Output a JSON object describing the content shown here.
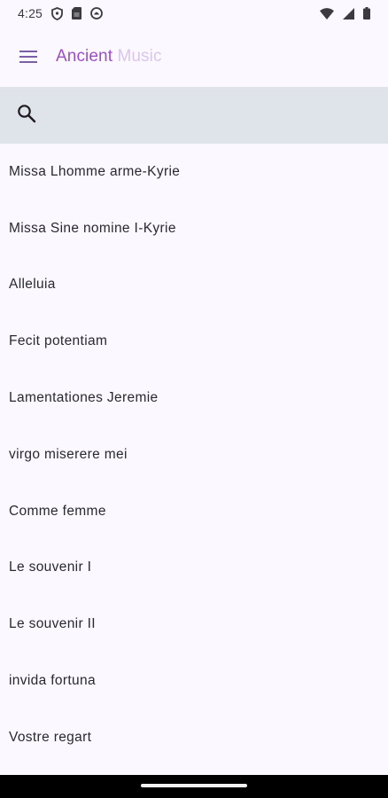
{
  "status_bar": {
    "time": "4:25",
    "left_icons": [
      "shield-icon",
      "sim-card-icon",
      "vpn-badge-icon"
    ],
    "right_icons": [
      "wifi-icon",
      "cell-signal-icon",
      "battery-icon"
    ]
  },
  "app_bar": {
    "title_part1": "Ancient",
    "title_part2": " Music",
    "menu_icon": "hamburger-menu-icon"
  },
  "search": {
    "icon": "search-icon",
    "value": "",
    "placeholder": ""
  },
  "songs": [
    "Missa Lhomme arme-Kyrie",
    "Missa Sine nomine I-Kyrie",
    "Alleluia",
    "Fecit potentiam",
    "Lamentationes Jeremie",
    "virgo miserere mei",
    "Comme femme",
    "Le souvenir I",
    "Le souvenir II",
    "invida fortuna",
    "Vostre regart"
  ],
  "colors": {
    "background": "#fbf9ff",
    "title_primary": "#9c4fc4",
    "title_secondary": "#d9c6ec",
    "search_bg": "#dfe3ea"
  }
}
